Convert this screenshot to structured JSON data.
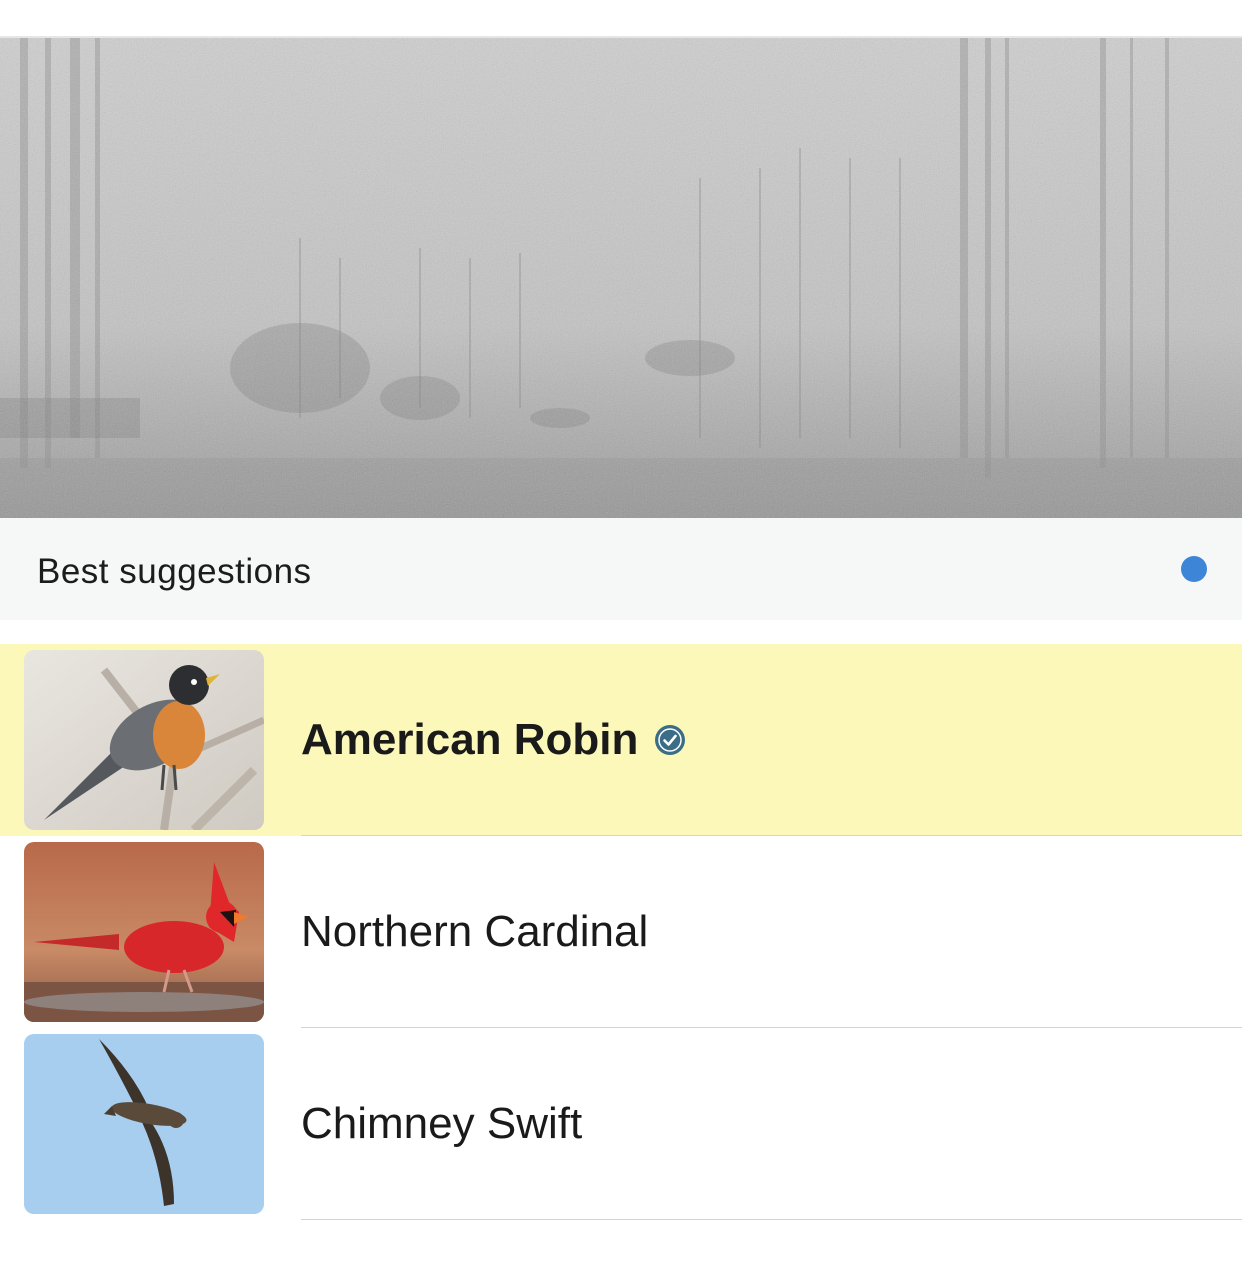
{
  "header": {
    "title": "Best suggestions",
    "indicator_color": "#3d85d6"
  },
  "suggestions": [
    {
      "name": "American Robin",
      "verified": true,
      "selected": true,
      "image": "american-robin-photo"
    },
    {
      "name": "Northern Cardinal",
      "verified": false,
      "selected": false,
      "image": "northern-cardinal-photo"
    },
    {
      "name": "Chimney Swift",
      "verified": false,
      "selected": false,
      "image": "chimney-swift-photo"
    }
  ],
  "colors": {
    "selected_row": "#fbf8b9",
    "verified_badge": "#3b6e86",
    "header_background": "#f6f7f7"
  }
}
